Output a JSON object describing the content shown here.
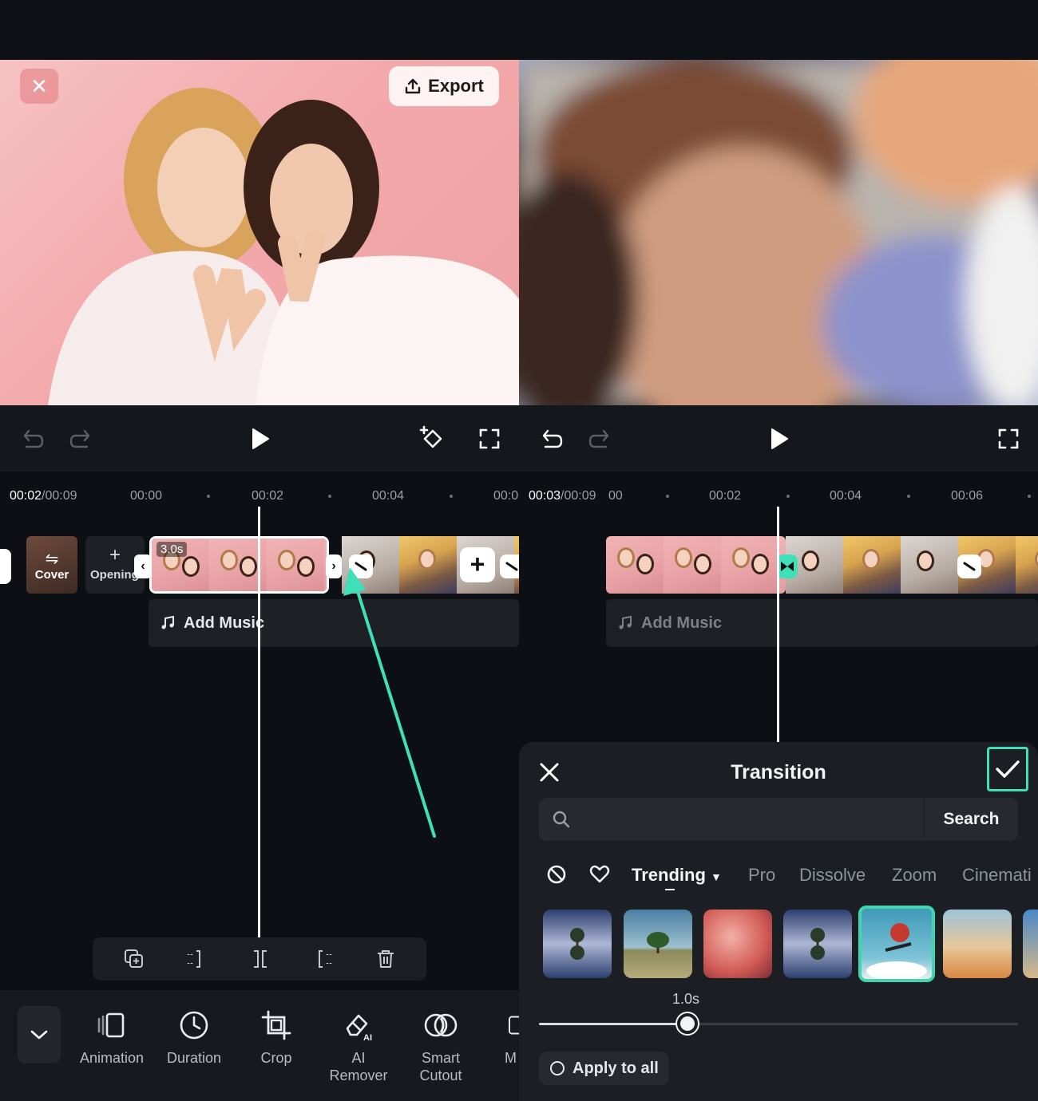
{
  "left": {
    "export_label": "Export",
    "time_current": "00:02",
    "time_total": "/00:09",
    "ruler_ticks": [
      "00:00",
      "00:02",
      "00:04",
      "00:0"
    ],
    "cover_label": "Cover",
    "opening_label": "Opening",
    "clip_duration": "3.0s",
    "add_music_label": "Add Music",
    "tools": [
      {
        "label": "Animation",
        "icon": "animation-icon"
      },
      {
        "label": "Duration",
        "icon": "clock-icon"
      },
      {
        "label": "Crop",
        "icon": "crop-icon"
      },
      {
        "label": "AI\nRemover",
        "icon": "ai-eraser-icon"
      },
      {
        "label": "Smart\nCutout",
        "icon": "smart-cutout-icon"
      },
      {
        "label": "M",
        "icon": "more-tool-icon"
      }
    ]
  },
  "right": {
    "time_current": "00:03",
    "time_total": "/00:09",
    "ruler_ticks": [
      "00",
      "00:02",
      "00:04",
      "00:06"
    ],
    "add_music_label": "Add Music",
    "sheet": {
      "title": "Transition",
      "search_label": "Search",
      "search_placeholder": "",
      "categories": [
        "Trending",
        "Pro",
        "Dissolve",
        "Zoom",
        "Cinemati"
      ],
      "active_category": "Trending",
      "duration_value": "1.0s",
      "duration_fraction": 0.31,
      "apply_all_label": "Apply to all"
    }
  },
  "colors": {
    "accent": "#3fe0b8",
    "background": "#0c0f13"
  }
}
